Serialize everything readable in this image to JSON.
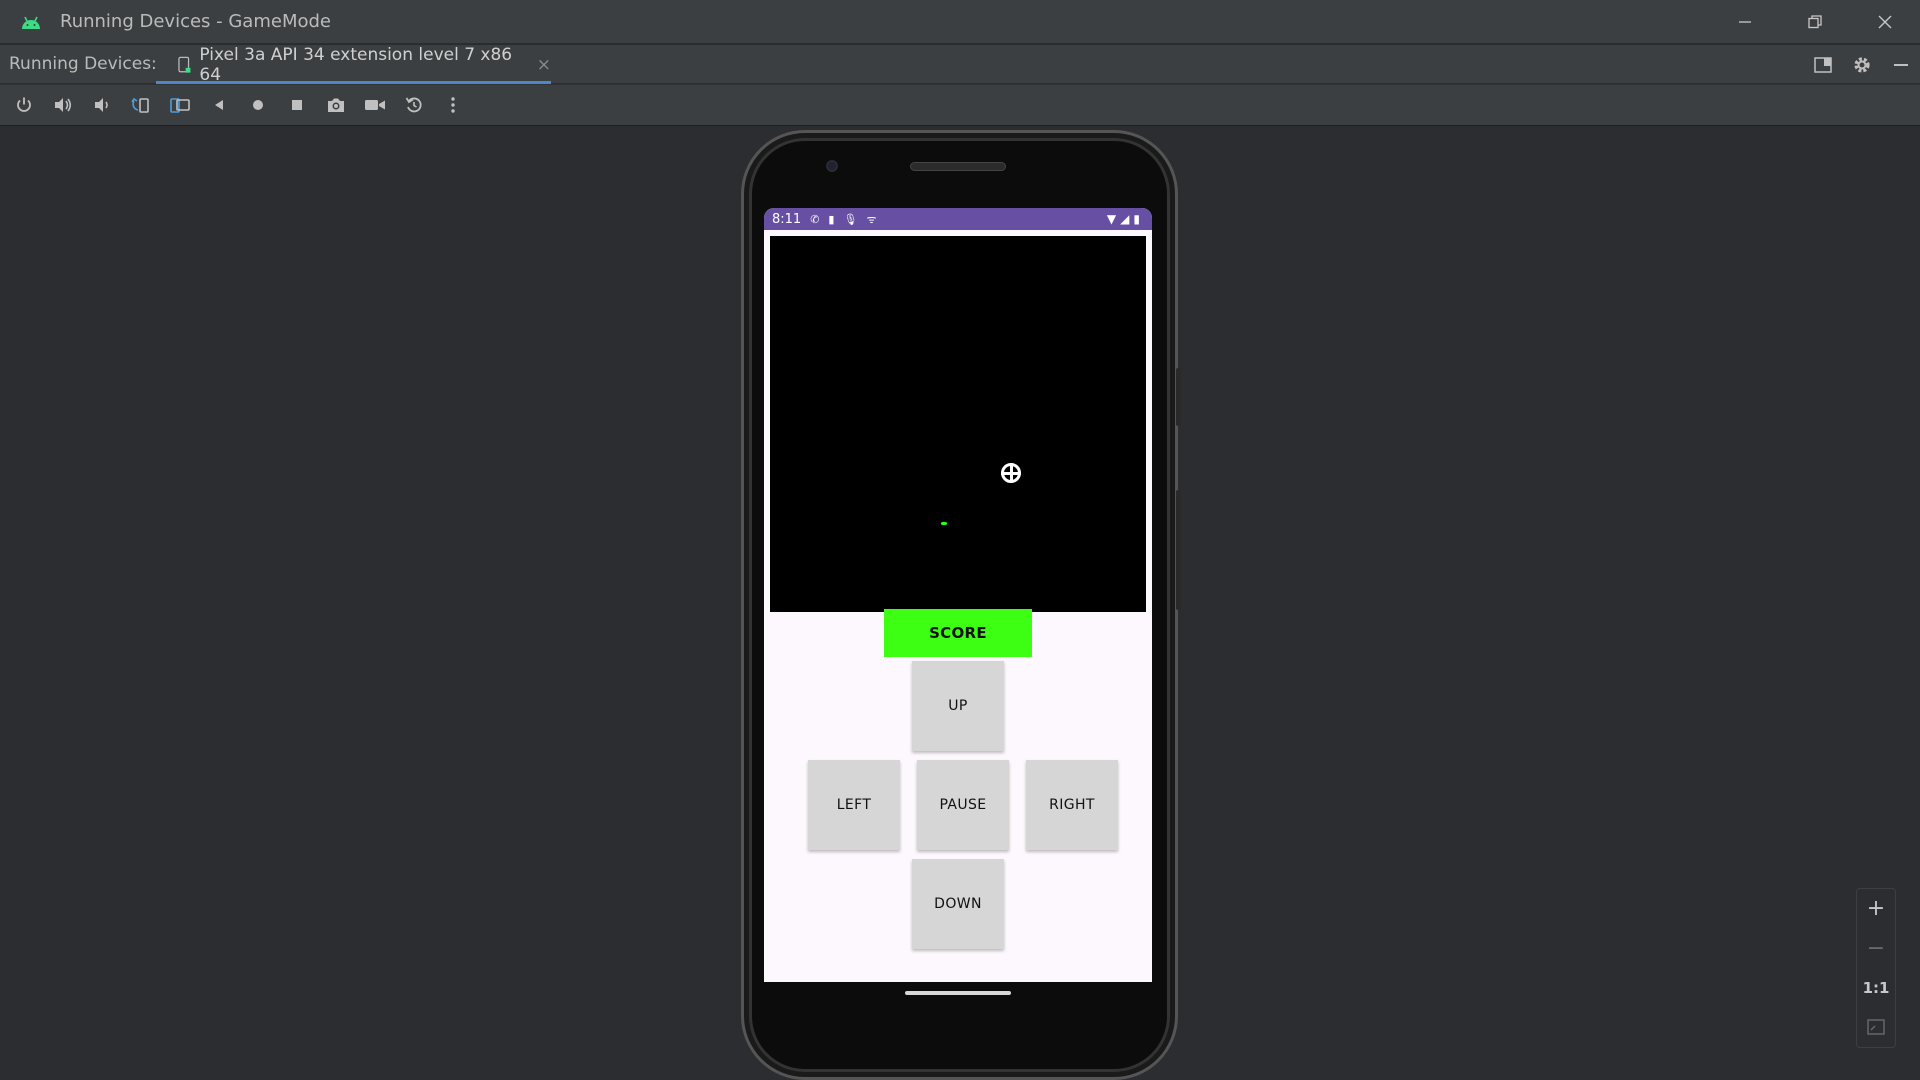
{
  "window": {
    "title": "Running Devices - GameMode"
  },
  "tabbar": {
    "label": "Running Devices:",
    "tab_title": "Pixel 3a API 34 extension level 7 x86 64",
    "tab_close": "×"
  },
  "toolbar": {
    "buttons": [
      "power-icon",
      "volume-up-icon",
      "volume-down-icon",
      "rotate-left-icon",
      "rotate-right-icon",
      "back-icon",
      "home-icon",
      "overview-icon",
      "screenshot-icon",
      "screen-record-icon",
      "reset-icon",
      "more-icon"
    ]
  },
  "phone": {
    "status_time": "8:11",
    "status_color": "#6750a4",
    "app": {
      "score_label": "SCORE",
      "up_label": "UP",
      "left_label": "LEFT",
      "pause_label": "PAUSE",
      "right_label": "RIGHT",
      "down_label": "DOWN",
      "score_color": "#3cff14",
      "food_color": "#2aff1a"
    }
  },
  "zoom": {
    "zoom_in": "+",
    "zoom_out": "−",
    "actual_size": "1:1"
  }
}
